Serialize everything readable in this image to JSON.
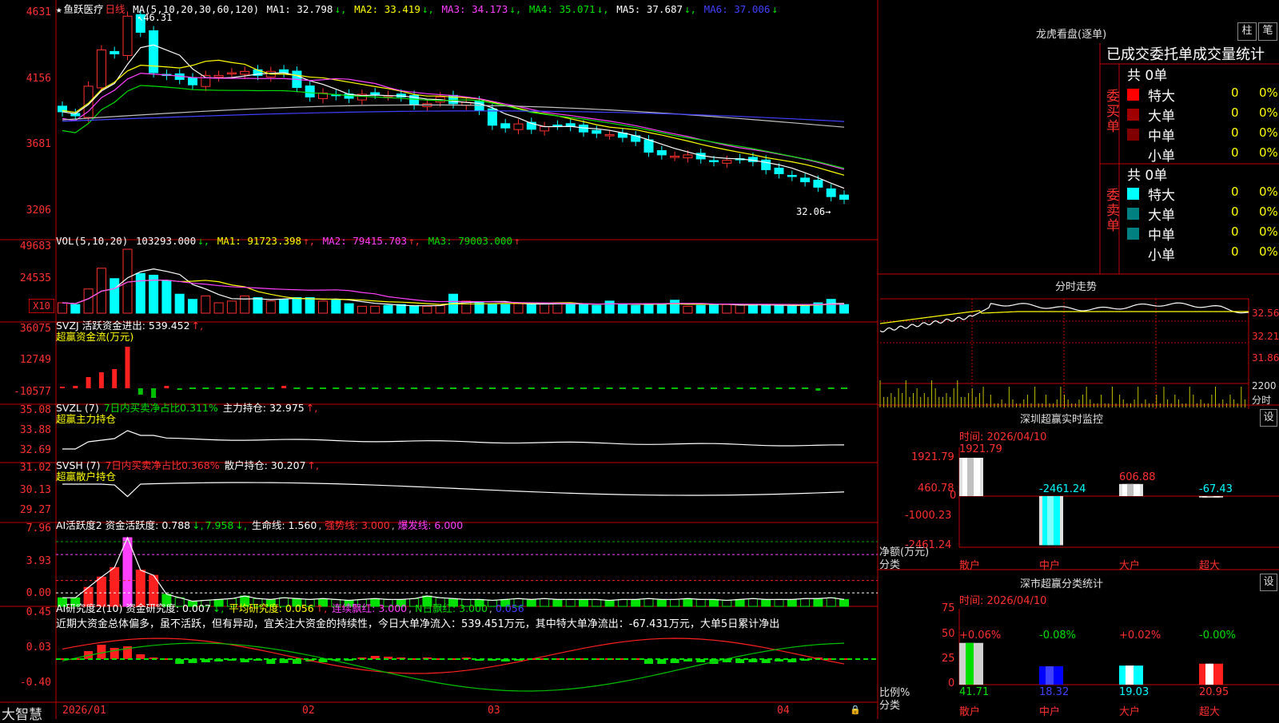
{
  "stock": {
    "star": "★",
    "name": "鱼跃医疗",
    "period": "日线",
    "high_mark": "46.31",
    "low_mark": "32.06"
  },
  "kline": {
    "ma_header": "MA(5,10,20,30,60,120)",
    "ma1": "MA1: 32.798",
    "ma2": "MA2: 33.419",
    "ma3": "MA3: 34.173",
    "ma4": "MA4: 35.071",
    "ma5": "MA5: 37.687",
    "ma6": "MA6: 37.006",
    "yticks": [
      "4631",
      "4156",
      "3681",
      "3206"
    ]
  },
  "vol": {
    "header": "VOL(5,10,20)",
    "vol_value": "103293.000",
    "ma1": "MA1: 91723.398",
    "ma2": "MA2: 79415.703",
    "ma3": "MA3: 79003.000",
    "yticks": [
      "49683",
      "24535"
    ],
    "unit": "X10"
  },
  "svzj": {
    "header": "SVZJ  活跃资金进出: 539.452",
    "sub": "超赢资金流(万元)",
    "yticks": [
      "36075",
      "12749",
      "-10577"
    ]
  },
  "svzl": {
    "header": "SVZL (7)",
    "pct": "7日内买卖净占比0.311%",
    "hold": "主力持仓: 32.975",
    "sub": "超赢主力持仓",
    "yticks": [
      "35.08",
      "33.88",
      "32.69"
    ]
  },
  "svsh": {
    "header": "SVSH (7)",
    "pct": "7日内买卖净占比0.368%",
    "hold": "散户持仓: 30.207",
    "sub": "超赢散户持仓",
    "yticks": [
      "31.02",
      "30.13",
      "29.27"
    ]
  },
  "ai1": {
    "header": "AI活跃度2 资金活跃度: 0.788",
    "v2": "7.958",
    "life": "生命线: 1.560",
    "strong": "强势线: 3.000",
    "burst": "爆发线: 6.000",
    "yticks": [
      "7.96",
      "3.93",
      "0.00"
    ]
  },
  "ai2": {
    "header": "AI研究度2(10) 资金研究度: 0.007",
    "avg": "平均研究度: 0.056",
    "cont": "连续飘红: 3.000",
    "nday": "N日飘红: 3.000",
    "last": "0.056",
    "comment": "近期大资金总体偏多，虽不活跃，但有异动，宜关注大资金的持续性，今日大单净流入：539.451万元，其中特大单净流出：-67.431万元，大单5日累计净出",
    "yticks": [
      "0.45",
      "0.03",
      "-0.40"
    ]
  },
  "xaxis": {
    "labels": [
      "2026/01",
      "02",
      "03",
      "04"
    ],
    "brand": "大智慧"
  },
  "right": {
    "lhb_title": "龙虎看盘(逐单)",
    "btn_bar": "柱",
    "btn_pen": "笔",
    "tabs": [
      "已成交",
      "委托单",
      "成交量统计"
    ],
    "buy_label": "委买单",
    "sell_label": "委卖单",
    "buy_total": "共 0单",
    "sell_total": "共 0单",
    "rows": [
      {
        "name": "特大",
        "count": "0",
        "pct": "0%"
      },
      {
        "name": "大单",
        "count": "0",
        "pct": "0%"
      },
      {
        "name": "中单",
        "count": "0",
        "pct": "0%"
      },
      {
        "name": "小单",
        "count": "0",
        "pct": "0%"
      }
    ],
    "fenshi_title": "分时走势",
    "fenshi_prices": [
      "32.56",
      "32.21",
      "31.86"
    ],
    "fenshi_vol": "2200",
    "fenshi_vol_unit": "分时",
    "monitor_title": "深圳超赢实时监控",
    "monitor_btn": "设",
    "monitor_time": "时间: 2026/04/10",
    "monitor_yticks": [
      "1921.79",
      "460.78",
      "0",
      "-1000.23",
      "-2461.24"
    ],
    "monitor_values": [
      "1921.79",
      "-2461.24",
      "606.88",
      "-67.43"
    ],
    "monitor_axis_label": "净额(万元)",
    "monitor_axis_label2": "分类",
    "categories": [
      "散户",
      "中户",
      "大户",
      "超大"
    ],
    "stat_title": "深市超赢分类统计",
    "stat_btn": "设",
    "stat_time": "时间: 2026/04/10",
    "stat_yticks": [
      "75",
      "50",
      "25",
      "0"
    ],
    "stat_deltas": [
      "+0.06%",
      "-0.08%",
      "+0.02%",
      "-0.00%"
    ],
    "stat_values": [
      "41.71",
      "18.32",
      "19.03",
      "20.95"
    ],
    "stat_axis_label": "比例%",
    "stat_axis_label2": "分类"
  },
  "colors": {
    "up": "#ff3030",
    "down": "#00ffff",
    "grid": "#c00000",
    "ma1": "#ffffff",
    "ma2": "#ffff00",
    "ma3": "#ff40ff",
    "ma4": "#00e000",
    "ma5": "#c0c0c0",
    "ma6": "#4040ff"
  }
}
